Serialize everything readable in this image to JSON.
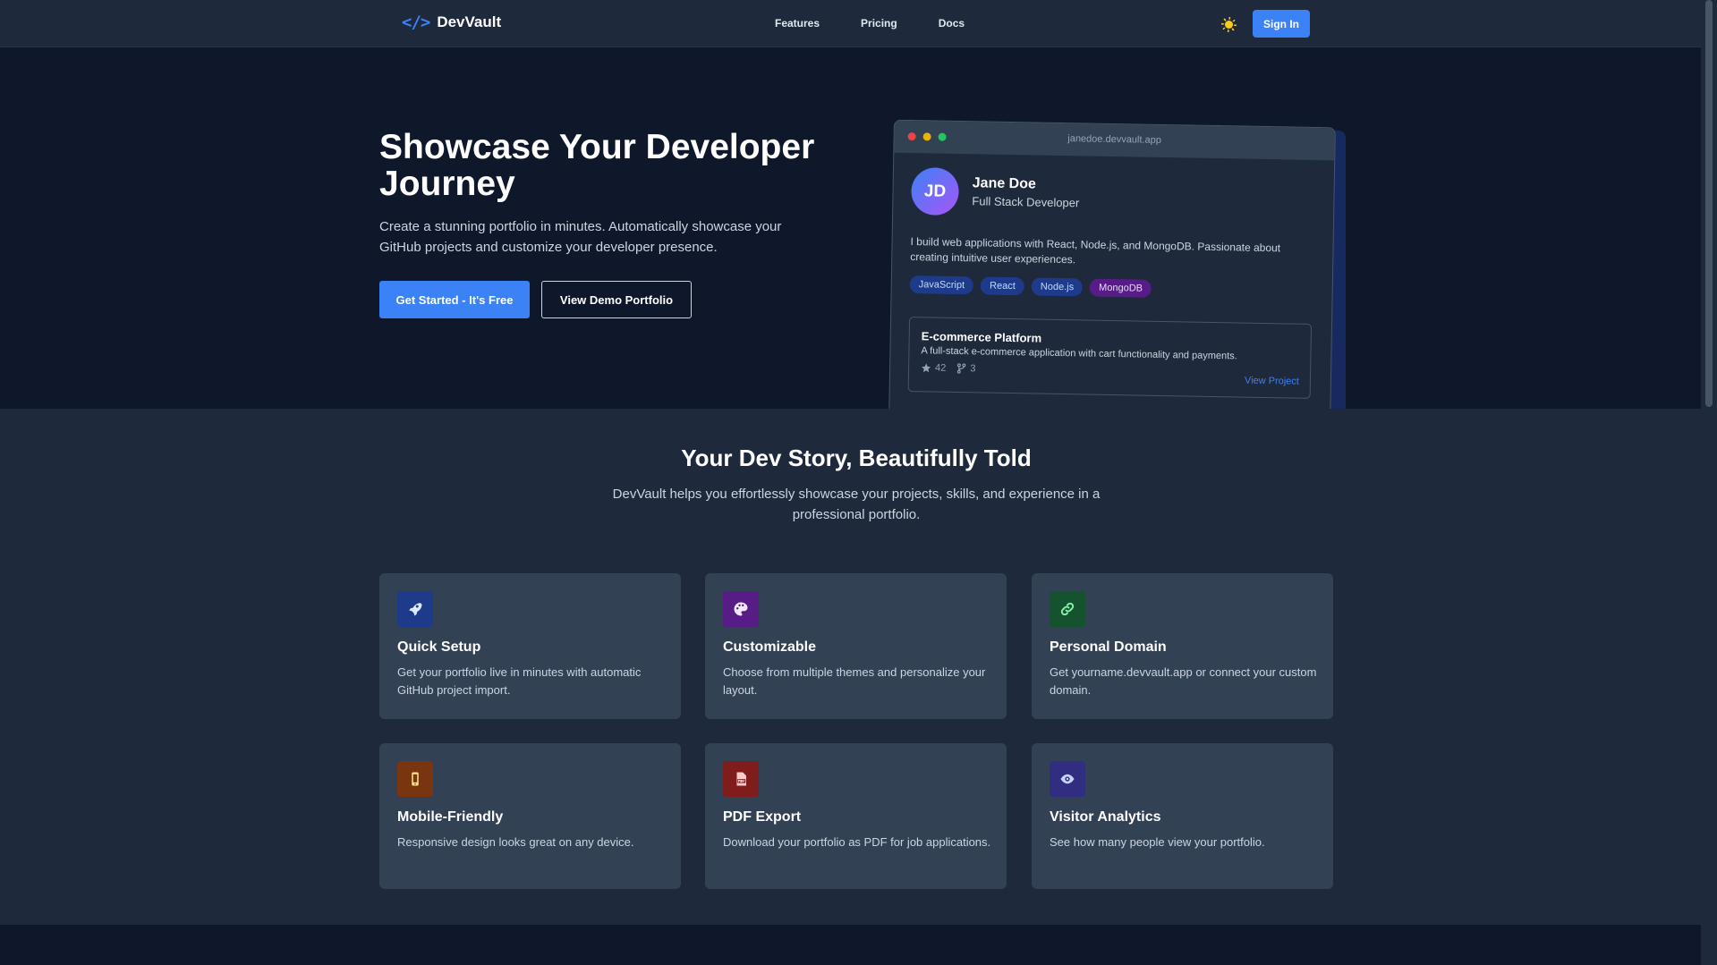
{
  "nav": {
    "logo_icon": "</>",
    "logo_text": "DevVault",
    "links": [
      "Features",
      "Pricing",
      "Docs"
    ],
    "theme_icon": "sun-icon",
    "sign_in": "Sign In"
  },
  "hero": {
    "title": "Showcase Your Developer Journey",
    "description": "Create a stunning portfolio in minutes. Automatically showcase your GitHub projects and customize your developer presence.",
    "primary_cta": "Get Started - It's Free",
    "secondary_cta": "View Demo Portfolio"
  },
  "demo": {
    "url": "janedoe.devvault.app",
    "initials": "JD",
    "name": "Jane Doe",
    "role": "Full Stack Developer",
    "bio": "I build web applications with React, Node.js, and MongoDB. Passionate about creating intuitive user experiences.",
    "tags": [
      "JavaScript",
      "React",
      "Node.js",
      "MongoDB"
    ],
    "project": {
      "title": "E-commerce Platform",
      "description": "A full-stack e-commerce application with cart functionality and payments.",
      "stars": "42",
      "forks": "3",
      "link": "View Project"
    }
  },
  "features": {
    "title": "Your Dev Story, Beautifully Told",
    "description": "DevVault helps you effortlessly showcase your projects, skills, and experience in a professional portfolio.",
    "items": [
      {
        "title": "Quick Setup",
        "description": "Get your portfolio live in minutes with automatic GitHub project import.",
        "icon": "rocket-icon",
        "color": "#1e3a8a"
      },
      {
        "title": "Customizable",
        "description": "Choose from multiple themes and personalize your layout.",
        "icon": "palette-icon",
        "color": "#581c87"
      },
      {
        "title": "Personal Domain",
        "description": "Get yourname.devvault.app or connect your custom domain.",
        "icon": "link-icon",
        "color": "#14532d"
      },
      {
        "title": "Mobile-Friendly",
        "description": "Responsive design looks great on any device.",
        "icon": "mobile-icon",
        "color": "#78350f"
      },
      {
        "title": "PDF Export",
        "description": "Download your portfolio as PDF for job applications.",
        "icon": "pdf-icon",
        "color": "#7f1d1d"
      },
      {
        "title": "Visitor Analytics",
        "description": "See how many people view your portfolio.",
        "icon": "eye-icon",
        "color": "#312e81"
      }
    ]
  }
}
